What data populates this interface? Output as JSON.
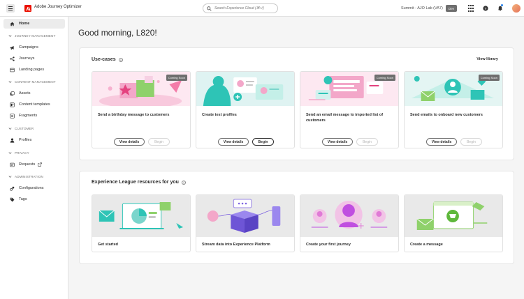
{
  "header": {
    "app_title": "Adobe Journey Optimizer",
    "search_placeholder": "Search Experience Cloud (⌘+/)",
    "org": "Summit - AJO Lab (VA7)",
    "sandbox": "Dev"
  },
  "sidebar": {
    "home": "Home",
    "sections": [
      {
        "title": "JOURNEY MANAGEMENT",
        "items": [
          "Campaigns",
          "Journeys",
          "Landing pages"
        ]
      },
      {
        "title": "CONTENT MANAGEMENT",
        "items": [
          "Assets",
          "Content templates",
          "Fragments"
        ]
      },
      {
        "title": "CUSTOMER",
        "items": [
          "Profiles"
        ]
      },
      {
        "title": "PRIVACY",
        "items": [
          "Requests"
        ]
      },
      {
        "title": "ADMINISTRATION",
        "items": [
          "Configurations",
          "Tags"
        ]
      }
    ]
  },
  "main": {
    "greeting": "Good morning, L820!",
    "use_cases": {
      "title": "Use-cases",
      "view_library": "View library",
      "view_details": "View details",
      "begin": "Begin",
      "coming_soon": "Coming Soon",
      "cards": [
        {
          "title": "Send a birthday message to customers",
          "coming_soon": true
        },
        {
          "title": "Create test profiles",
          "coming_soon": false
        },
        {
          "title": "Send an email message to imported list of customers",
          "coming_soon": true
        },
        {
          "title": "Send emails to onboard new customers",
          "coming_soon": true
        }
      ]
    },
    "resources": {
      "title": "Experience League resources for you",
      "cards": [
        {
          "title": "Get started"
        },
        {
          "title": "Stream data into Experience Platform"
        },
        {
          "title": "Create your first journey"
        },
        {
          "title": "Create a message"
        }
      ]
    }
  },
  "colors": {
    "brand": "#eb1000",
    "pink": "#f5c6de",
    "teal": "#2ec4b6",
    "purple": "#c04fe0"
  }
}
